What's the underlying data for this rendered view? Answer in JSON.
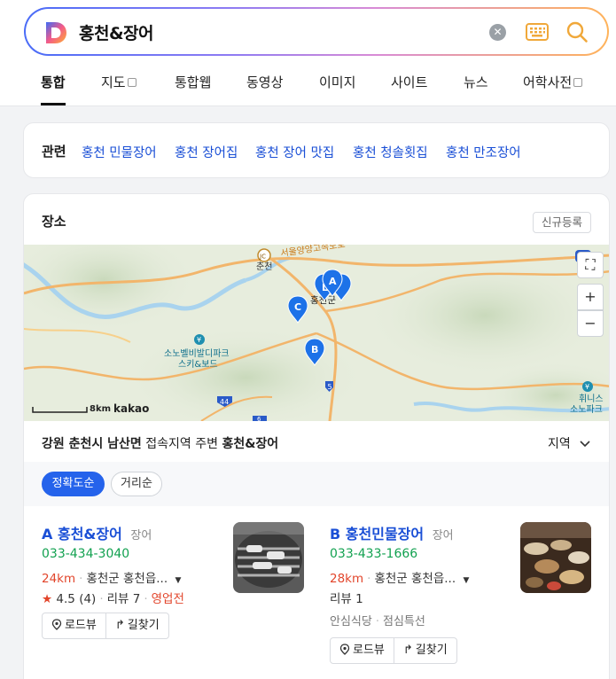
{
  "search": {
    "query": "홍천&장어"
  },
  "tabs": [
    {
      "label": "통합",
      "active": true
    },
    {
      "label": "지도"
    },
    {
      "label": "통합웹"
    },
    {
      "label": "동영상"
    },
    {
      "label": "이미지"
    },
    {
      "label": "사이트"
    },
    {
      "label": "뉴스"
    },
    {
      "label": "어학사전"
    }
  ],
  "related": {
    "title": "관련",
    "links": [
      "홍천 민물장어",
      "홍천 장어집",
      "홍천 장어 맛집",
      "홍천 청솔횟집",
      "홍천 만조장어"
    ]
  },
  "place": {
    "title": "장소",
    "register_label": "신규등록",
    "map": {
      "labels": {
        "chuncheon": "춘천",
        "jc": "JC",
        "expressway": "서울양양고속도로",
        "hongcheon": "홍천군",
        "resort1": "소노벨비발디파크",
        "resort2": "스키&보드",
        "hwinis1": "휘니스",
        "hwinis2": "소노파크"
      },
      "road_numbers": [
        "5",
        "44",
        "6"
      ],
      "markers": [
        "A",
        "B",
        "C",
        "L"
      ],
      "scale": "8km",
      "brand": "kakao"
    },
    "area": {
      "region": "강원 춘천시 남산면",
      "middle": "접속지역 주변",
      "query": "홍천&장어"
    },
    "region_filter": "지역",
    "sort": {
      "accuracy": "정확도순",
      "distance": "거리순"
    },
    "results": [
      {
        "marker": "A",
        "name": "홍천&장어",
        "category": "장어",
        "phone": "033-434-3040",
        "distance": "24km",
        "address": "홍천군 홍천읍...",
        "rating": "4.5",
        "rating_count": "(4)",
        "reviews": "리뷰 7",
        "status": "영업전",
        "roadview": "로드뷰",
        "directions": "길찾기"
      },
      {
        "marker": "B",
        "name": "홍천민물장어",
        "category": "장어",
        "phone": "033-433-1666",
        "distance": "28km",
        "address": "홍천군 홍천읍...",
        "reviews": "리뷰 1",
        "tag1": "안심식당",
        "tag2": "점심특선",
        "roadview": "로드뷰",
        "directions": "길찾기"
      }
    ]
  }
}
